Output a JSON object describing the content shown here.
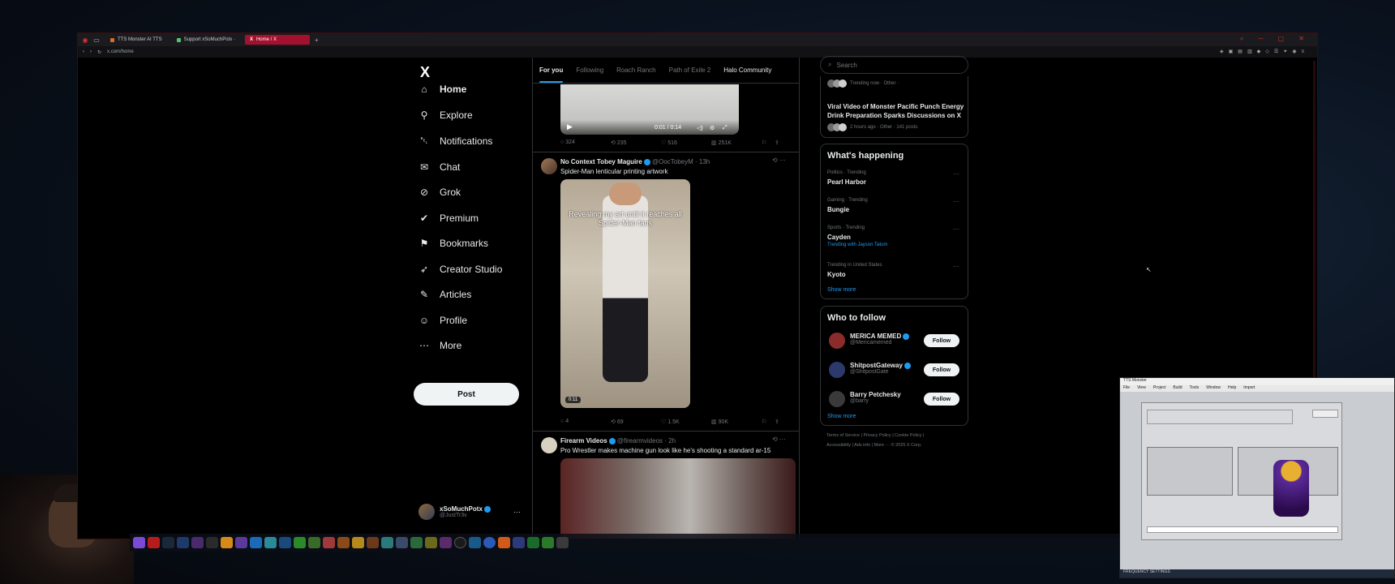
{
  "browser": {
    "tabs": [
      {
        "label": "TTS Monster AI TTS",
        "active": false
      },
      {
        "label": "Support xSoMuchPotx · ",
        "active": false
      },
      {
        "label": "Home / X",
        "active": true
      }
    ],
    "url": "x.com/home"
  },
  "sidebar": {
    "logo": "X",
    "items": [
      {
        "label": "Home",
        "icon": "home-icon",
        "glyph": "⌂"
      },
      {
        "label": "Explore",
        "icon": "search-icon",
        "glyph": "⚲"
      },
      {
        "label": "Notifications",
        "icon": "bell-icon",
        "glyph": "␇"
      },
      {
        "label": "Chat",
        "icon": "mail-icon",
        "glyph": "✉"
      },
      {
        "label": "Grok",
        "icon": "grok-icon",
        "glyph": "⊘"
      },
      {
        "label": "Premium",
        "icon": "premium-icon",
        "glyph": "✔"
      },
      {
        "label": "Bookmarks",
        "icon": "bookmark-icon",
        "glyph": "⚑"
      },
      {
        "label": "Creator Studio",
        "icon": "rocket-icon",
        "glyph": "➶"
      },
      {
        "label": "Articles",
        "icon": "article-icon",
        "glyph": "✎"
      },
      {
        "label": "Profile",
        "icon": "person-icon",
        "glyph": "☺"
      },
      {
        "label": "More",
        "icon": "more-icon",
        "glyph": "⋯"
      }
    ],
    "post_label": "Post",
    "account": {
      "name": "xSoMuchPotx",
      "handle": "@JustTr3v",
      "more": "···"
    }
  },
  "feed": {
    "tabs": [
      "For you",
      "Following",
      "Roach Ranch",
      "Path of Exile 2",
      "Halo Community"
    ],
    "video1": {
      "time": "0:01 / 0:14"
    },
    "tweet1_stats": {
      "replies": "324",
      "reposts": "235",
      "likes": "516",
      "views": "251K"
    },
    "tweet2": {
      "name": "No Context Tobey Maguire",
      "handle": "@OocTobeyM · 13h",
      "text": "Spider-Man lenticular printing artwork",
      "caption": "Revealing my art until it reaches all Spider-Man fans",
      "duration": "0:11",
      "stats": {
        "replies": "4",
        "reposts": "69",
        "likes": "1.5K",
        "views": "90K"
      }
    },
    "tweet3": {
      "name": "Firearm Videos",
      "handle": "@firearmvideos · 2h",
      "text": "Pro Wrestler makes machine gun look like he's shooting a standard ar-15"
    }
  },
  "right": {
    "search_placeholder": "Search",
    "trending_now": {
      "label": "Trending now · Other ·",
      "headline": "Viral Video of Monster Pacific Punch Energy Drink Preparation Sparks Discussions on X",
      "meta": "2 hours ago · Other · 141 posts"
    },
    "happening": {
      "title": "What's happening",
      "items": [
        {
          "category": "Politics · Trending",
          "name": "Pearl Harbor",
          "extra": ""
        },
        {
          "category": "Gaming · Trending",
          "name": "Bungie",
          "extra": ""
        },
        {
          "category": "Sports · Trending",
          "name": "Cayden",
          "extra": "Trending with Jayson Tatum"
        },
        {
          "category": "Trending in United States",
          "name": "Kyoto",
          "extra": ""
        }
      ],
      "show_more": "Show more"
    },
    "who_to_follow": {
      "title": "Who to follow",
      "items": [
        {
          "name": "MERICA MEMED",
          "handle": "@Mericamemed",
          "button": "Follow",
          "color": "#8c2b2b"
        },
        {
          "name": "ShitpostGateway",
          "handle": "@ShitpostGate",
          "button": "Follow",
          "color": "#2b3a6a"
        },
        {
          "name": "Barry Petchesky",
          "handle": "@barry",
          "button": "Follow",
          "color": "#3a3a3a"
        }
      ],
      "show_more": "Show more"
    },
    "footer": {
      "line1": "Terms of Service  |  Privacy Policy  |  Cookie Policy  |",
      "line2": "Accessibility  |  Ads info  |  More ···  © 2025 X Corp."
    }
  },
  "app_window": {
    "title": "TTS Monster",
    "menu": [
      "File",
      "View",
      "Project",
      "Build",
      "Tools",
      "Window",
      "Help",
      "Import"
    ],
    "status": "FREQUENCY SETTINGS"
  }
}
